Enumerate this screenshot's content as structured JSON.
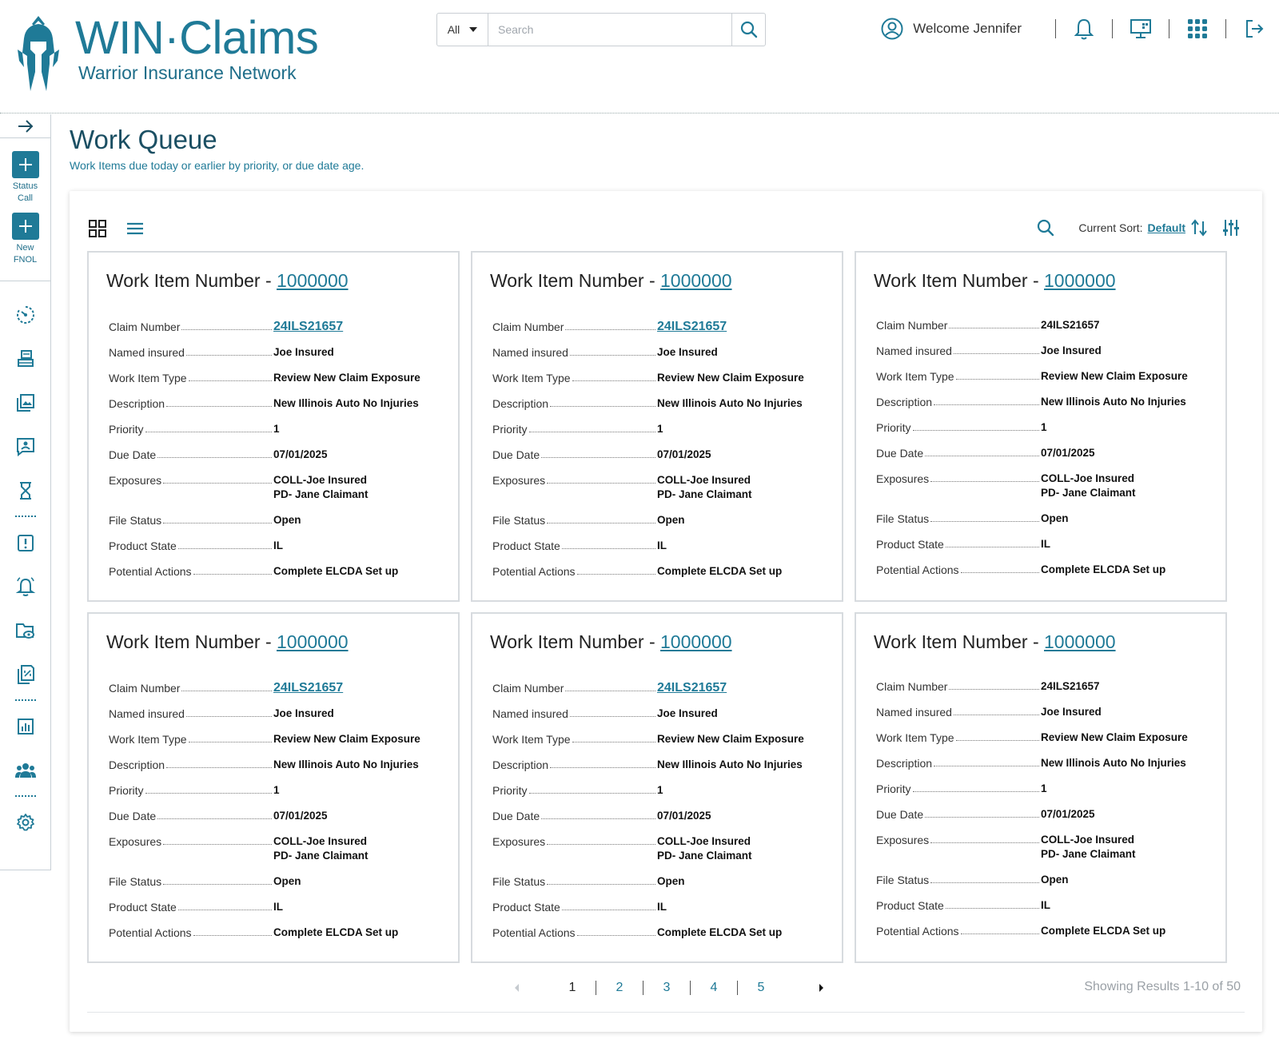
{
  "brand": {
    "title_win": "WIN",
    "title_dot": "·",
    "title_claims": "Claims",
    "subtitle": "Warrior Insurance Network",
    "primary_color": "#1f7a97"
  },
  "search": {
    "scope": "All",
    "placeholder": "Search"
  },
  "user": {
    "welcome": "Welcome Jennifer"
  },
  "sidebar": {
    "actions": [
      {
        "label_line1": "Status",
        "label_line2": "Call"
      },
      {
        "label_line1": "New",
        "label_line2": "FNOL"
      }
    ]
  },
  "page": {
    "title": "Work Queue",
    "subtitle": "Work Items due today or earlier by priority, or due date age."
  },
  "toolbar": {
    "sort_label": "Current Sort:",
    "sort_value": "Default"
  },
  "card_labels": {
    "title_prefix": "Work Item Number - ",
    "claim_number": "Claim Number",
    "named_insured": "Named insured",
    "work_item_type": "Work Item Type",
    "description": "Description",
    "priority": "Priority",
    "due_date": "Due Date",
    "exposures": "Exposures",
    "file_status": "File Status",
    "product_state": "Product State",
    "potential_actions": "Potential Actions"
  },
  "cards": [
    {
      "number": "1000000",
      "claim_number": "24ILS21657",
      "claim_link": true,
      "named_insured": "Joe Insured",
      "work_item_type": "Review New Claim Exposure",
      "description": "New Illinois Auto No Injuries",
      "priority": "1",
      "due_date": "07/01/2025",
      "exposure_1": "COLL-Joe Insured",
      "exposure_2": "PD- Jane Claimant",
      "file_status": "Open",
      "product_state": "IL",
      "potential_actions": "Complete ELCDA Set up"
    },
    {
      "number": "1000000",
      "claim_number": "24ILS21657",
      "claim_link": true,
      "named_insured": "Joe Insured",
      "work_item_type": "Review New Claim Exposure",
      "description": "New Illinois Auto No Injuries",
      "priority": "1",
      "due_date": "07/01/2025",
      "exposure_1": "COLL-Joe Insured",
      "exposure_2": "PD- Jane Claimant",
      "file_status": "Open",
      "product_state": "IL",
      "potential_actions": "Complete ELCDA Set up"
    },
    {
      "number": "1000000",
      "claim_number": "24ILS21657",
      "claim_link": false,
      "named_insured": "Joe Insured",
      "work_item_type": "Review New Claim Exposure",
      "description": "New Illinois Auto No Injuries",
      "priority": "1",
      "due_date": "07/01/2025",
      "exposure_1": "COLL-Joe Insured",
      "exposure_2": "PD- Jane Claimant",
      "file_status": "Open",
      "product_state": "IL",
      "potential_actions": "Complete ELCDA Set up"
    },
    {
      "number": "1000000",
      "claim_number": "24ILS21657",
      "claim_link": true,
      "named_insured": "Joe Insured",
      "work_item_type": "Review New Claim Exposure",
      "description": "New Illinois Auto No Injuries",
      "priority": "1",
      "due_date": "07/01/2025",
      "exposure_1": "COLL-Joe Insured",
      "exposure_2": "PD- Jane Claimant",
      "file_status": "Open",
      "product_state": "IL",
      "potential_actions": "Complete ELCDA Set up"
    },
    {
      "number": "1000000",
      "claim_number": "24ILS21657",
      "claim_link": true,
      "named_insured": "Joe Insured",
      "work_item_type": "Review New Claim Exposure",
      "description": "New Illinois Auto No Injuries",
      "priority": "1",
      "due_date": "07/01/2025",
      "exposure_1": "COLL-Joe Insured",
      "exposure_2": "PD- Jane Claimant",
      "file_status": "Open",
      "product_state": "IL",
      "potential_actions": "Complete ELCDA Set up"
    },
    {
      "number": "1000000",
      "claim_number": "24ILS21657",
      "claim_link": false,
      "named_insured": "Joe Insured",
      "work_item_type": "Review New Claim Exposure",
      "description": "New Illinois Auto No Injuries",
      "priority": "1",
      "due_date": "07/01/2025",
      "exposure_1": "COLL-Joe Insured",
      "exposure_2": "PD- Jane Claimant",
      "file_status": "Open",
      "product_state": "IL",
      "potential_actions": "Complete ELCDA Set up"
    }
  ],
  "pagination": {
    "pages": [
      "1",
      "2",
      "3",
      "4",
      "5"
    ],
    "current": "1",
    "results": "Showing Results 1-10 of 50"
  }
}
